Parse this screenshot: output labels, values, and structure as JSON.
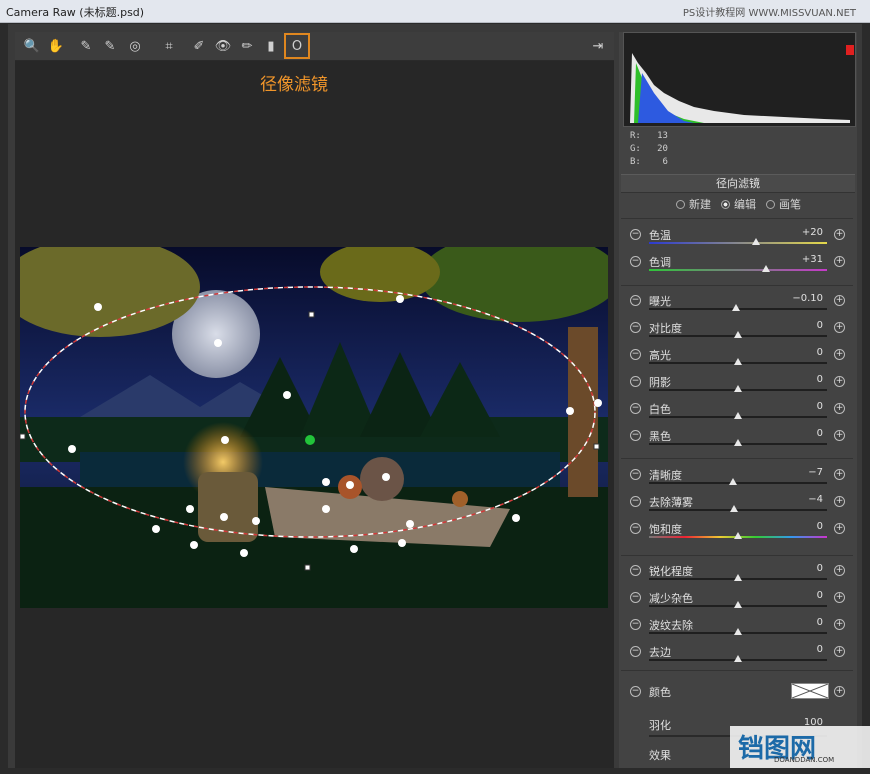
{
  "window": {
    "title": "Camera Raw (未标题.psd)",
    "watermark_top": "PS设计教程网 WWW.MISSVUAN.NET"
  },
  "toolbar": {
    "tools": [
      {
        "name": "zoom-tool",
        "icon": "🔍"
      },
      {
        "name": "hand-tool",
        "icon": "✋"
      },
      {
        "name": "white-balance-tool",
        "icon": "✎"
      },
      {
        "name": "color-sampler-tool",
        "icon": "✎"
      },
      {
        "name": "targeted-adjustment-tool",
        "icon": "◎"
      },
      {
        "name": "crop-tool",
        "icon": "⌗"
      },
      {
        "name": "spot-removal-tool",
        "icon": "✐"
      },
      {
        "name": "red-eye-tool",
        "icon": "👁"
      },
      {
        "name": "adjustment-brush-tool",
        "icon": "✏"
      },
      {
        "name": "graduated-filter-tool",
        "icon": "▮"
      },
      {
        "name": "radial-filter-tool",
        "icon": "O"
      }
    ],
    "open_prefs_icon": "⇥"
  },
  "annotation": "径像滤镜",
  "histogram": {
    "r_label": "R:",
    "r_value": "13",
    "g_label": "G:",
    "g_value": "20",
    "b_label": "B:",
    "b_value": "6"
  },
  "panel": {
    "title": "径向滤镜",
    "mode_new": "新建",
    "mode_edit": "编辑",
    "mode_brush": "画笔",
    "mode_selected": "编辑"
  },
  "sliders": [
    {
      "id": "temp",
      "label": "色温",
      "value": "+20",
      "pos": 0.6
    },
    {
      "id": "tint",
      "label": "色调",
      "value": "+31",
      "pos": 0.66
    },
    {
      "id": "exposure",
      "label": "曝光",
      "value": "−0.10",
      "pos": 0.49
    },
    {
      "id": "contrast",
      "label": "对比度",
      "value": "0",
      "pos": 0.5
    },
    {
      "id": "highlights",
      "label": "高光",
      "value": "0",
      "pos": 0.5
    },
    {
      "id": "shadows",
      "label": "阴影",
      "value": "0",
      "pos": 0.5
    },
    {
      "id": "whites",
      "label": "白色",
      "value": "0",
      "pos": 0.5
    },
    {
      "id": "blacks",
      "label": "黑色",
      "value": "0",
      "pos": 0.5
    },
    {
      "id": "clarity",
      "label": "清晰度",
      "value": "−7",
      "pos": 0.47
    },
    {
      "id": "dehaze",
      "label": "去除薄雾",
      "value": "−4",
      "pos": 0.48
    },
    {
      "id": "saturation",
      "label": "饱和度",
      "value": "0",
      "pos": 0.5
    },
    {
      "id": "sharpness",
      "label": "锐化程度",
      "value": "0",
      "pos": 0.5
    },
    {
      "id": "noise",
      "label": "减少杂色",
      "value": "0",
      "pos": 0.5
    },
    {
      "id": "moire",
      "label": "波纹去除",
      "value": "0",
      "pos": 0.5
    },
    {
      "id": "defringe",
      "label": "去边",
      "value": "0",
      "pos": 0.5
    }
  ],
  "color_label": "颜色",
  "feather_label": "羽化",
  "feather_value": "100",
  "effect_label": "效果",
  "logo_text": "铛图网",
  "logo_sub": "DOANDDAN.COM"
}
